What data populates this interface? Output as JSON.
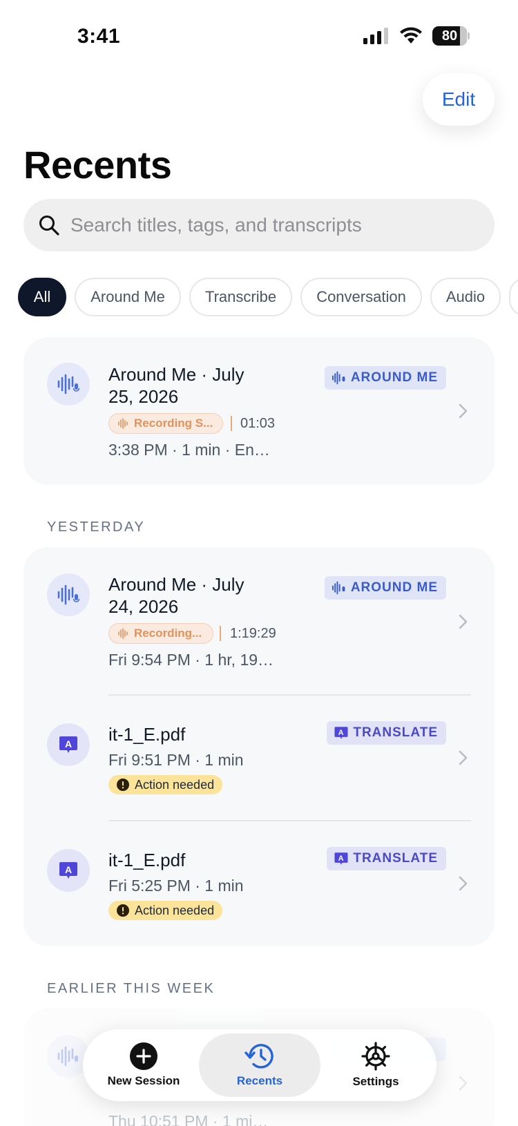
{
  "status_bar": {
    "time": "3:41",
    "battery": "80"
  },
  "header": {
    "edit_label": "Edit",
    "title": "Recents"
  },
  "search": {
    "placeholder": "Search titles, tags, and transcripts"
  },
  "filters": [
    "All",
    "Around Me",
    "Transcribe",
    "Conversation",
    "Audio"
  ],
  "active_filter": "All",
  "today": {
    "items": [
      {
        "title_line1": "Around Me · July",
        "title_line2": "25, 2026",
        "tag": "AROUND ME",
        "recording_label": "Recording S...",
        "duration": "01:03",
        "meta": "3:38 PM · 1 min · En…",
        "icon": "waveform-mic-icon"
      }
    ]
  },
  "yesterday": {
    "header": "YESTERDAY",
    "items": [
      {
        "title_line1": "Around Me · July",
        "title_line2": "24, 2026",
        "tag": "AROUND ME",
        "recording_label": "Recording...",
        "duration": "1:19:29",
        "meta": "Fri 9:54 PM · 1 hr, 19…",
        "icon": "waveform-mic-icon"
      },
      {
        "title": "it-1_E.pdf",
        "tag": "TRANSLATE",
        "meta": "Fri 9:51 PM · 1 min",
        "status": "Action needed",
        "icon": "translate-bubble-icon"
      },
      {
        "title": "it-1_E.pdf",
        "tag": "TRANSLATE",
        "meta": "Fri 5:25 PM · 1 min",
        "status": "Action needed",
        "icon": "translate-bubble-icon"
      }
    ]
  },
  "earlier": {
    "header": "EARLIER THIS WEEK",
    "items": [
      {
        "meta": "Thu 10:51 PM · 1 mi…",
        "icon": "waveform-mic-icon"
      }
    ]
  },
  "tab_bar": {
    "new_session": "New Session",
    "recents": "Recents",
    "settings": "Settings"
  },
  "colors": {
    "accent_blue": "#2563d6",
    "chip_active": "#0f172a",
    "tag_around_me": "#3b5bc6",
    "tag_translate": "#4b49c4",
    "recording_orange": "#e0935c",
    "action_yellow": "#fbe49a"
  }
}
